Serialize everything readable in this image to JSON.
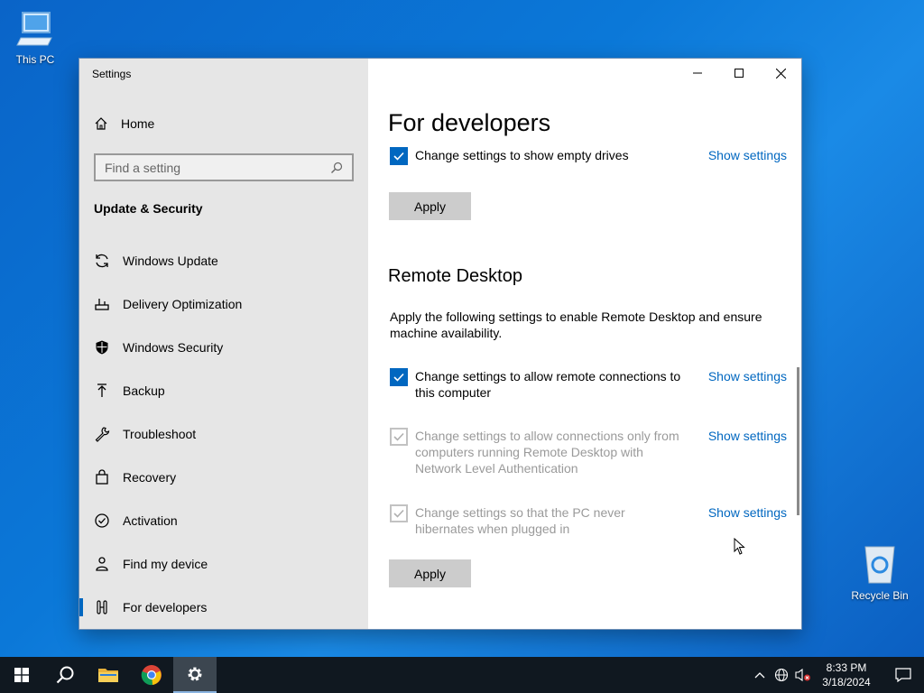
{
  "desktop": {
    "icons": [
      {
        "label": "This PC",
        "icon": "computer-icon"
      },
      {
        "label": "Recycle Bin",
        "icon": "recycle-bin-icon"
      }
    ]
  },
  "window": {
    "app_title": "Settings",
    "controls": {
      "minimize": "minimize-icon",
      "maximize": "maximize-icon",
      "close": "close-icon"
    }
  },
  "sidebar": {
    "home_label": "Home",
    "search_placeholder": "Find a setting",
    "section_title": "Update & Security",
    "items": [
      {
        "label": "Windows Update",
        "icon": "refresh-icon"
      },
      {
        "label": "Delivery Optimization",
        "icon": "delivery-icon"
      },
      {
        "label": "Windows Security",
        "icon": "shield-icon"
      },
      {
        "label": "Backup",
        "icon": "backup-arrow-icon"
      },
      {
        "label": "Troubleshoot",
        "icon": "wrench-icon"
      },
      {
        "label": "Recovery",
        "icon": "recovery-icon"
      },
      {
        "label": "Activation",
        "icon": "check-circle-icon"
      },
      {
        "label": "Find my device",
        "icon": "person-icon"
      },
      {
        "label": "For developers",
        "icon": "developer-tools-icon",
        "active": true
      }
    ]
  },
  "content": {
    "page_title": "For developers",
    "explorer_setting": {
      "text": "Change settings to show empty drives",
      "checked": true,
      "link": "Show settings"
    },
    "apply_label_1": "Apply",
    "remote_desktop": {
      "title": "Remote Desktop",
      "description": "Apply the following settings to enable Remote Desktop and ensure machine availability.",
      "settings": [
        {
          "text": "Change settings to allow remote connections to this computer",
          "checked": true,
          "enabled": true,
          "link": "Show settings"
        },
        {
          "text": "Change settings to allow connections only from computers running Remote Desktop with Network Level Authentication",
          "checked": true,
          "enabled": false,
          "link": "Show settings"
        },
        {
          "text": "Change settings so that the PC never hibernates when plugged in",
          "checked": true,
          "enabled": false,
          "link": "Show settings"
        }
      ]
    },
    "apply_label_2": "Apply"
  },
  "taskbar": {
    "buttons": [
      "start-icon",
      "search-icon",
      "file-explorer-icon",
      "chrome-icon",
      "settings-icon"
    ],
    "tray": {
      "time": "8:33 PM",
      "date": "3/18/2024"
    }
  },
  "colors": {
    "accent": "#0067c0",
    "taskbar": "#101820",
    "sidebar": "#e6e6e6"
  }
}
